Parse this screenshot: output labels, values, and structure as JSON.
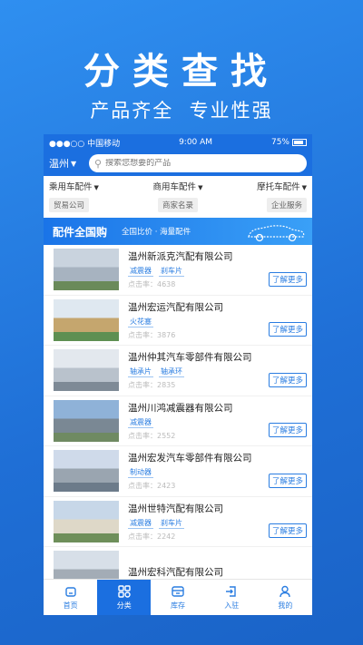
{
  "hero": {
    "title": "分类查找",
    "subtitle": "产品齐全  专业性强"
  },
  "statusbar": {
    "carrier": "●●●○○ 中国移动",
    "time": "9:00 AM",
    "battery": "75%"
  },
  "search": {
    "city": "温州",
    "placeholder": "搜索您想要的产品"
  },
  "categories": [
    "乘用车配件",
    "商用车配件",
    "摩托车配件"
  ],
  "tags": [
    "贸易公司",
    "商家名录",
    "企业服务"
  ],
  "banner": {
    "title": "配件全国购",
    "subtitle": "全国比价 · 海量配件"
  },
  "companies": [
    {
      "name": "温州新派克汽配有限公司",
      "parts": [
        "减震器",
        "刹车片"
      ],
      "clicks": "点击率：4638",
      "more": "了解更多"
    },
    {
      "name": "温州宏运汽配有限公司",
      "parts": [
        "火花塞"
      ],
      "clicks": "点击率：3876",
      "more": "了解更多"
    },
    {
      "name": "温州仲其汽车零部件有限公司",
      "parts": [
        "轴承片",
        "轴承环"
      ],
      "clicks": "点击率：2835",
      "more": "了解更多"
    },
    {
      "name": "温州川鸿减震器有限公司",
      "parts": [
        "减震器"
      ],
      "clicks": "点击率：2552",
      "more": "了解更多"
    },
    {
      "name": "温州宏发汽车零部件有限公司",
      "parts": [
        "制动器"
      ],
      "clicks": "点击率：2423",
      "more": "了解更多"
    },
    {
      "name": "温州世特汽配有限公司",
      "parts": [
        "减震器",
        "刹车片"
      ],
      "clicks": "点击率：2242",
      "more": "了解更多"
    },
    {
      "name": "温州宏科汽配有限公司",
      "parts": [],
      "clicks": "",
      "more": ""
    }
  ],
  "tabs": [
    {
      "label": "首页",
      "icon": "home-icon"
    },
    {
      "label": "分类",
      "icon": "category-icon",
      "active": true
    },
    {
      "label": "库存",
      "icon": "inventory-icon"
    },
    {
      "label": "入驻",
      "icon": "enter-icon"
    },
    {
      "label": "我的",
      "icon": "user-icon"
    }
  ],
  "colors": {
    "primary": "#1b6fe0",
    "link": "#2a7de1",
    "background": "#2f8ff0"
  }
}
